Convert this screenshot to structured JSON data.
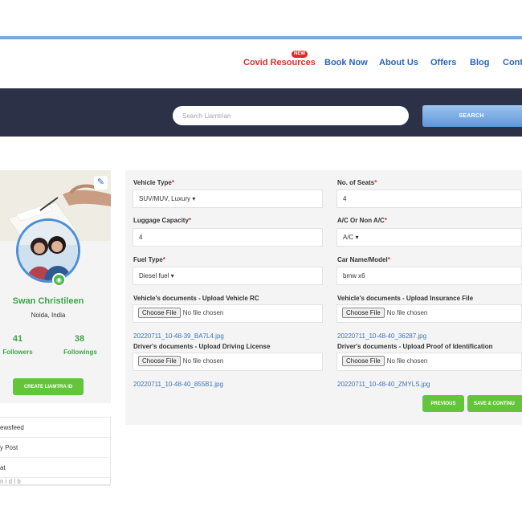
{
  "nav": {
    "badge": "NEW",
    "items": [
      "Covid Resources",
      "Book Now",
      "About Us",
      "Offers",
      "Blog",
      "Conta"
    ]
  },
  "search": {
    "placeholder": "Search Liamtrian",
    "button": "SEARCH"
  },
  "profile": {
    "name": "Swan Christileen",
    "location": "Noida, India",
    "followers_count": "41",
    "followers_label": "Followers",
    "followings_count": "38",
    "followings_label": "Followings",
    "create_button": "CREATE LIAMTRA ID"
  },
  "menu": [
    "ewsfeed",
    "y Post",
    "at",
    "    n  i   d   l  b"
  ],
  "form": {
    "vehicle_type": {
      "label": "Vehicle Type",
      "value": "SUV/MUV, Luxury ▾"
    },
    "seats": {
      "label": "No. of Seats",
      "value": "4"
    },
    "luggage": {
      "label": "Luggage Capacity",
      "value": "4"
    },
    "ac": {
      "label": "A/C Or Non A/C",
      "value": "A/C ▾"
    },
    "fuel": {
      "label": "Fuel Type",
      "value": "Diesel fuel ▾"
    },
    "car_name": {
      "label": "Car Name/Model",
      "value": "bmw x6"
    },
    "required_mark": "*",
    "choose_file": "Choose File",
    "no_file": "No file chosen",
    "rc": {
      "label": "Vehicle's documents - Upload Vehicle RC",
      "file": "20220711_10-48-39_BA7L4.jpg"
    },
    "insurance": {
      "label": "Vehicle's documents - Upload Insurance File",
      "file": "20220711_10-48-40_36287.jpg"
    },
    "license": {
      "label": "Driver's documents - Upload Driving License",
      "file": "20220711_10-48-40_855B1.jpg"
    },
    "identification": {
      "label": "Driver's documents - Upload Proof of Identification",
      "file": "20220711_10-48-40_ZMYLS.jpg"
    },
    "previous_button": "PREVIOUS",
    "save_button": "SAVE & CONTINU"
  },
  "colors": {
    "accent_green": "#63c63a",
    "banner": "#2c3147",
    "link_blue": "#2d66b5",
    "covid_red": "#d8302c"
  }
}
